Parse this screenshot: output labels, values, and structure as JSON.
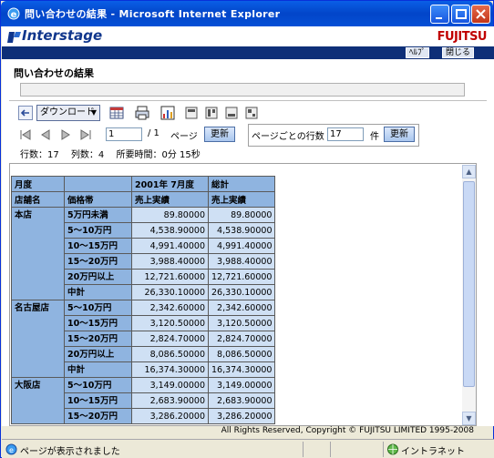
{
  "window": {
    "title": "問い合わせの結果 - Microsoft Internet Explorer"
  },
  "header": {
    "logo_text": "Interstage",
    "brand": "FUJITSU",
    "help_label": "ﾍﾙﾌﾟ",
    "close_label": "閉じる"
  },
  "page": {
    "title": "問い合わせの結果"
  },
  "toolbar": {
    "download_label": "ダウンロード",
    "page_value": "1",
    "page_total": "/ 1",
    "page_unit": "ページ",
    "update_label": "更新",
    "rows_per_page_label": "ページごとの行数",
    "rows_per_page_value": "17",
    "rows_unit": "件",
    "update_label_2": "更新"
  },
  "info": {
    "rows": "行数：17",
    "cols": "列数：4",
    "elapsed": "所要時間：0分 15秒"
  },
  "table": {
    "h1_col1": "月度",
    "h1_col3": "2001年 7月度",
    "h1_col4": "総計",
    "h2_col1": "店舗名",
    "h2_col2": "価格帯",
    "h2_col3": "売上実績",
    "h2_col4": "売上実績",
    "groups": [
      {
        "store": "本店",
        "rows": [
          {
            "band": "5万円未満",
            "v1": "89.80000",
            "v2": "89.80000"
          },
          {
            "band": "5～10万円",
            "v1": "4,538.90000",
            "v2": "4,538.90000"
          },
          {
            "band": "10～15万円",
            "v1": "4,991.40000",
            "v2": "4,991.40000"
          },
          {
            "band": "15～20万円",
            "v1": "3,988.40000",
            "v2": "3,988.40000"
          },
          {
            "band": "20万円以上",
            "v1": "12,721.60000",
            "v2": "12,721.60000"
          },
          {
            "band": "中計",
            "v1": "26,330.10000",
            "v2": "26,330.10000"
          }
        ]
      },
      {
        "store": "名古屋店",
        "rows": [
          {
            "band": "5～10万円",
            "v1": "2,342.60000",
            "v2": "2,342.60000"
          },
          {
            "band": "10～15万円",
            "v1": "3,120.50000",
            "v2": "3,120.50000"
          },
          {
            "band": "15～20万円",
            "v1": "2,824.70000",
            "v2": "2,824.70000"
          },
          {
            "band": "20万円以上",
            "v1": "8,086.50000",
            "v2": "8,086.50000"
          },
          {
            "band": "中計",
            "v1": "16,374.30000",
            "v2": "16,374.30000"
          }
        ]
      },
      {
        "store": "大阪店",
        "rows": [
          {
            "band": "5～10万円",
            "v1": "3,149.00000",
            "v2": "3,149.00000"
          },
          {
            "band": "10～15万円",
            "v1": "2,683.90000",
            "v2": "2,683.90000"
          },
          {
            "band": "15～20万円",
            "v1": "3,286.20000",
            "v2": "3,286.20000"
          }
        ]
      }
    ]
  },
  "footer": {
    "copyright": "All Rights Reserved, Copyright © FUJITSU LIMITED 1995-2008"
  },
  "status": {
    "text": "ページが表示されました",
    "zone": "イントラネット"
  },
  "colors": {
    "header_cell": "#8fb4e0",
    "value_cell": "#cfe0f4",
    "titlebar": "#0245c9",
    "nav_strip": "#0e2f78"
  }
}
